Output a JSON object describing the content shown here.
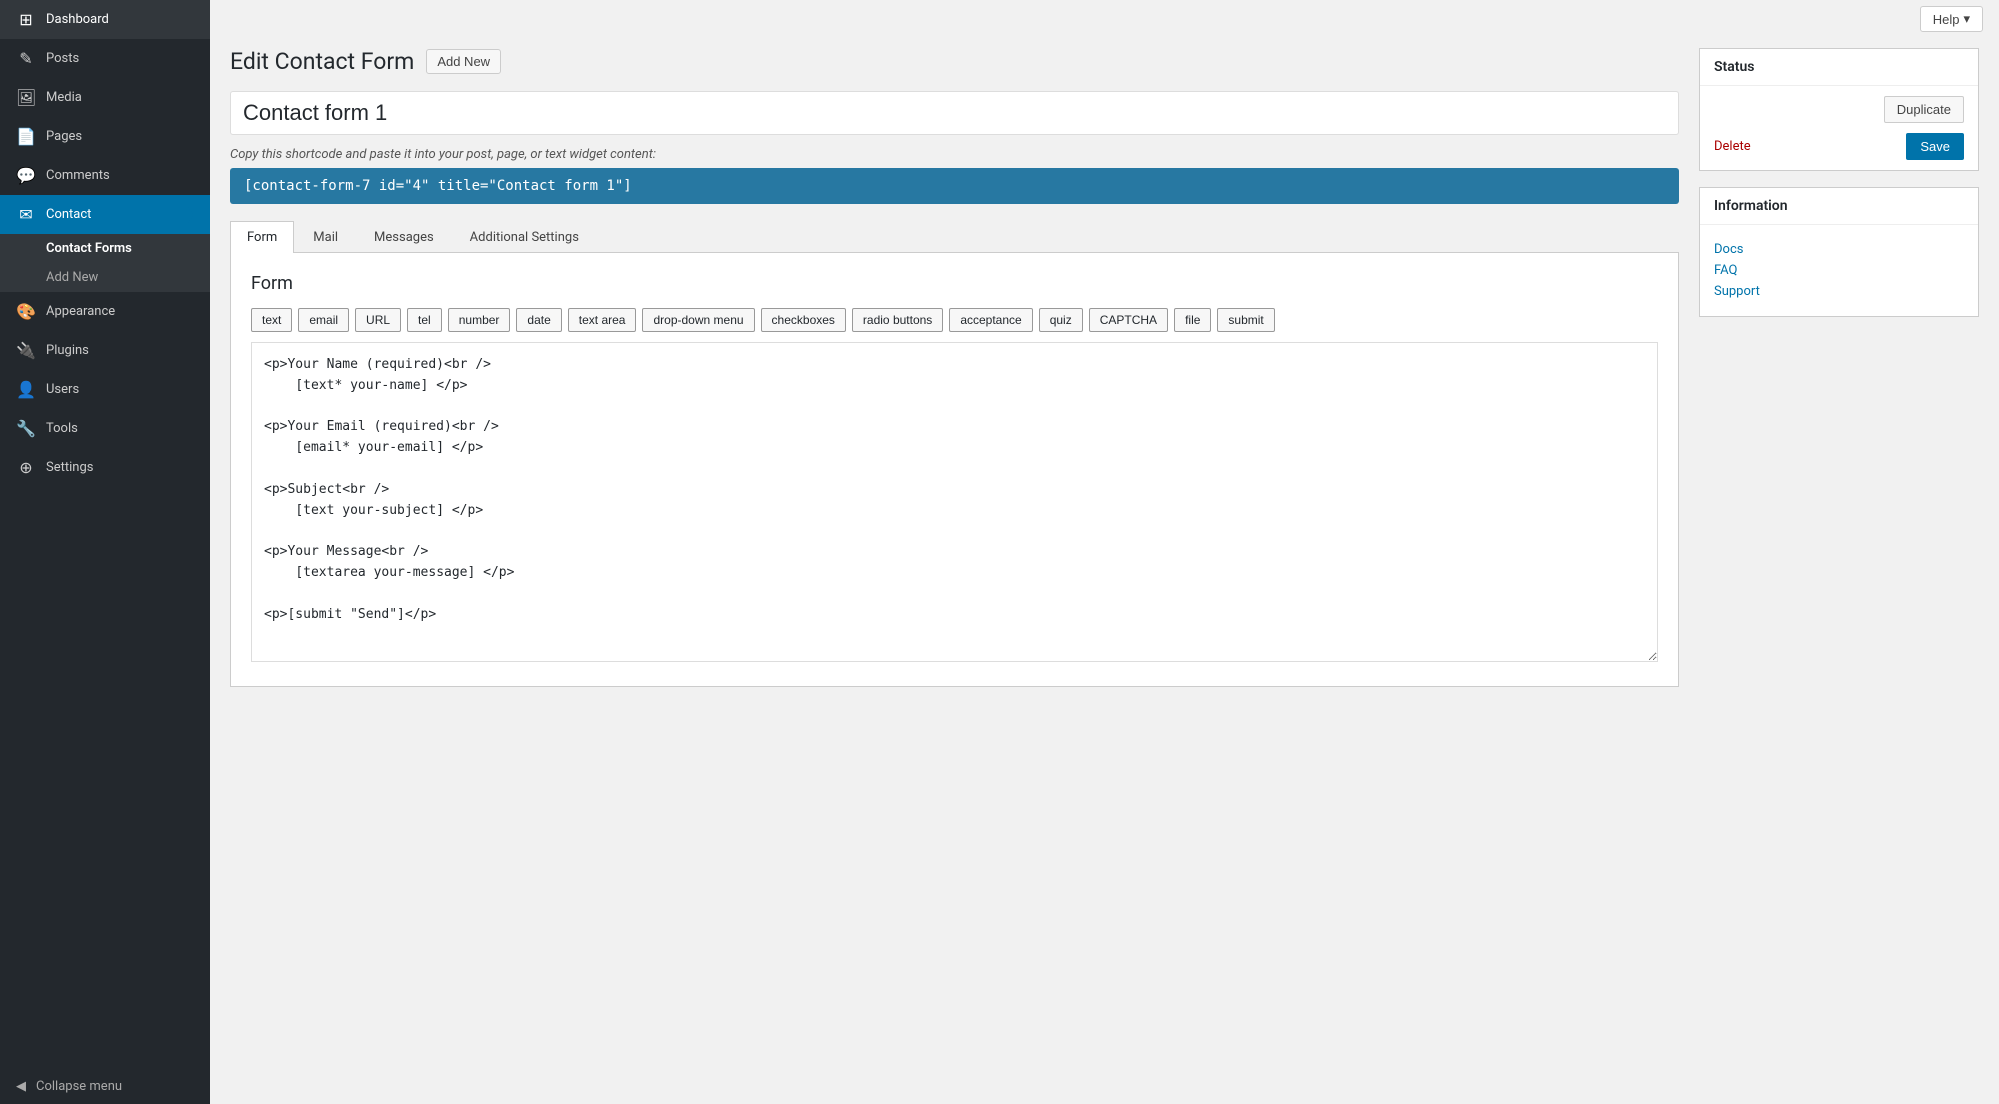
{
  "sidebar": {
    "items": [
      {
        "id": "dashboard",
        "label": "Dashboard",
        "icon": "⊞"
      },
      {
        "id": "posts",
        "label": "Posts",
        "icon": "✎"
      },
      {
        "id": "media",
        "label": "Media",
        "icon": "🖼"
      },
      {
        "id": "pages",
        "label": "Pages",
        "icon": "📄"
      },
      {
        "id": "comments",
        "label": "Comments",
        "icon": "💬"
      },
      {
        "id": "contact",
        "label": "Contact",
        "icon": "✉"
      },
      {
        "id": "appearance",
        "label": "Appearance",
        "icon": "🎨"
      },
      {
        "id": "plugins",
        "label": "Plugins",
        "icon": "🔌"
      },
      {
        "id": "users",
        "label": "Users",
        "icon": "👤"
      },
      {
        "id": "tools",
        "label": "Tools",
        "icon": "🔧"
      },
      {
        "id": "settings",
        "label": "Settings",
        "icon": "⊕"
      }
    ],
    "contact_submenu": [
      {
        "id": "contact-forms",
        "label": "Contact Forms"
      },
      {
        "id": "add-new",
        "label": "Add New"
      }
    ],
    "collapse_label": "Collapse menu"
  },
  "header": {
    "page_title": "Edit Contact Form",
    "add_new_label": "Add New",
    "help_label": "Help"
  },
  "form": {
    "name_value": "Contact form 1",
    "name_placeholder": "Contact form 1",
    "shortcode_label": "Copy this shortcode and paste it into your post, page, or text widget content:",
    "shortcode_value": "[contact-form-7 id=\"4\" title=\"Contact form 1\"]"
  },
  "tabs": [
    {
      "id": "form",
      "label": "Form",
      "active": true
    },
    {
      "id": "mail",
      "label": "Mail",
      "active": false
    },
    {
      "id": "messages",
      "label": "Messages",
      "active": false
    },
    {
      "id": "additional-settings",
      "label": "Additional Settings",
      "active": false
    }
  ],
  "form_editor": {
    "title": "Form",
    "tag_buttons": [
      "text",
      "email",
      "URL",
      "tel",
      "number",
      "date",
      "text area",
      "drop-down menu",
      "checkboxes",
      "radio buttons",
      "acceptance",
      "quiz",
      "CAPTCHA",
      "file",
      "submit"
    ],
    "textarea_content": "<p>Your Name (required)<br />\n    [text* your-name] </p>\n\n<p>Your Email (required)<br />\n    [email* your-email] </p>\n\n<p>Subject<br />\n    [text your-subject] </p>\n\n<p>Your Message<br />\n    [textarea your-message] </p>\n\n<p>[submit \"Send\"]</p>"
  },
  "status_box": {
    "title": "Status",
    "duplicate_label": "Duplicate",
    "delete_label": "Delete",
    "save_label": "Save"
  },
  "info_box": {
    "title": "Information",
    "links": [
      {
        "id": "docs",
        "label": "Docs"
      },
      {
        "id": "faq",
        "label": "FAQ"
      },
      {
        "id": "support",
        "label": "Support"
      }
    ]
  }
}
